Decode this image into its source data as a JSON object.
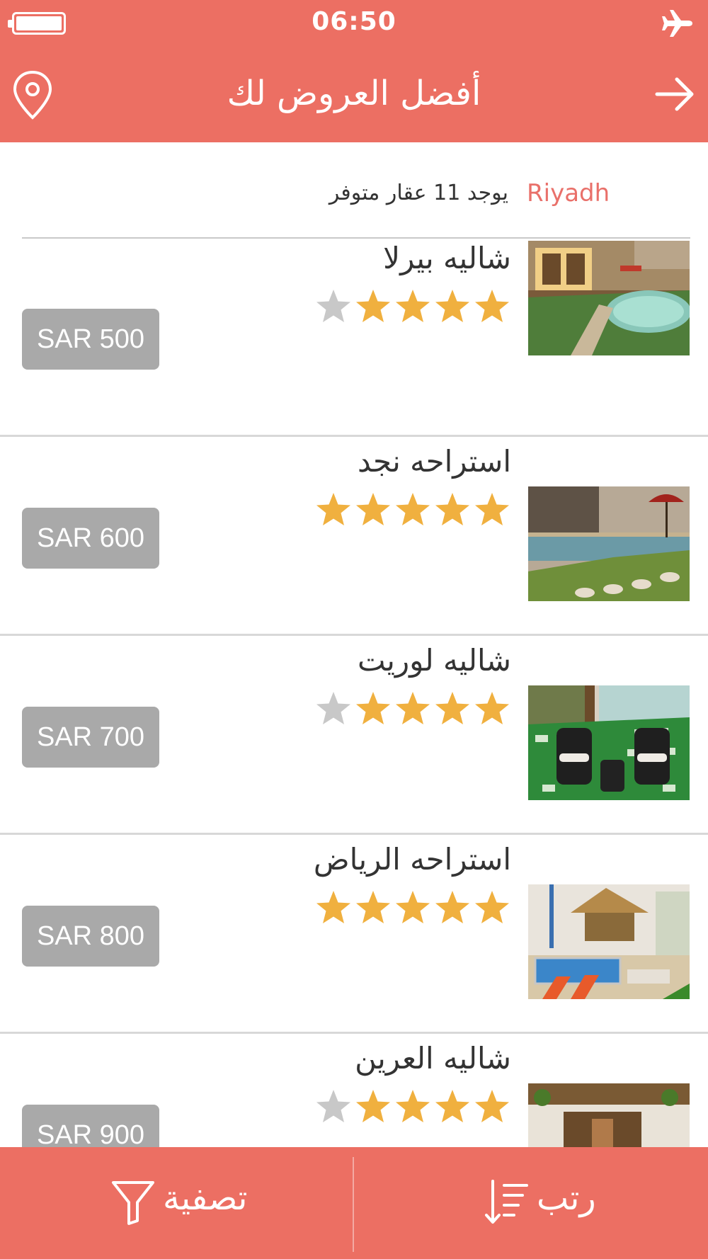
{
  "status_bar": {
    "time": "06:50",
    "battery_icon": "battery-full-icon",
    "mode_icon": "airplane-mode-icon"
  },
  "nav": {
    "title": "أفضل العروض لك",
    "left_icon": "location-pin-icon",
    "right_icon": "arrow-right-icon"
  },
  "summary": {
    "city": "Riyadh",
    "count_text": "يوجد 11 عقار متوفر"
  },
  "listings": [
    {
      "name": "شاليه بيرلا",
      "rating": 4,
      "max_rating": 5,
      "price": "SAR 500"
    },
    {
      "name": "استراحه نجد",
      "rating": 5,
      "max_rating": 5,
      "price": "SAR 600"
    },
    {
      "name": "شاليه لوريت",
      "rating": 4,
      "max_rating": 5,
      "price": "SAR 700"
    },
    {
      "name": "استراحه الرياض",
      "rating": 5,
      "max_rating": 5,
      "price": "SAR 800"
    },
    {
      "name": "شاليه العرين",
      "rating": 4,
      "max_rating": 5,
      "price": "SAR 900"
    }
  ],
  "tab_bar": {
    "sort_label": "رتب",
    "sort_icon": "sort-icon",
    "filter_label": "تصفية",
    "filter_icon": "filter-funnel-icon"
  },
  "colors": {
    "brand": "#ec6f63",
    "star_on": "#f0b03f",
    "star_off": "#c8c8c8",
    "price_badge": "#a9a9a9",
    "city_text": "#e9706a"
  }
}
